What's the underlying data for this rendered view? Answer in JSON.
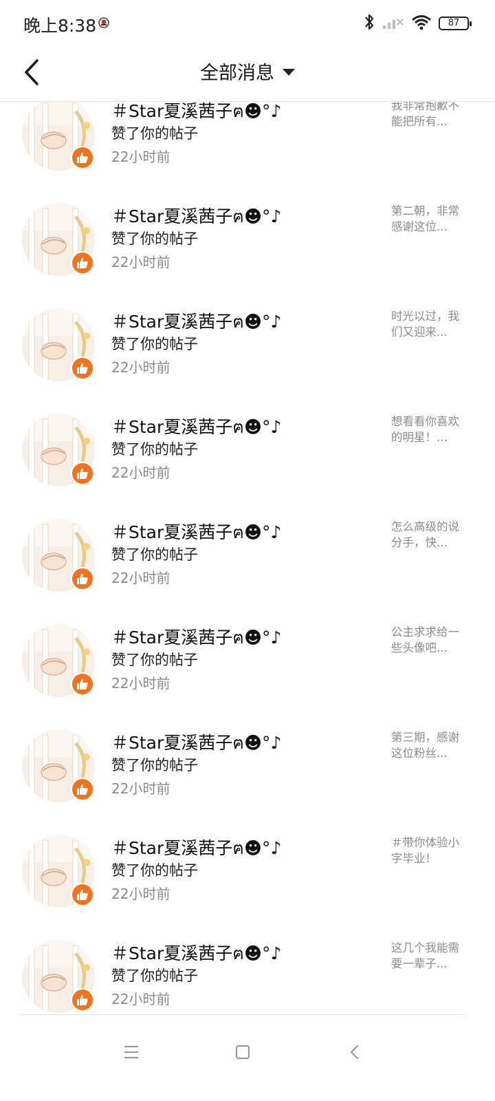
{
  "status_bar": {
    "time": "晚上8:38",
    "battery": "87",
    "icons": [
      "notification-icon",
      "bluetooth-icon",
      "signal-icon",
      "wifi-icon",
      "battery-icon"
    ]
  },
  "header": {
    "title": "全部消息",
    "back_icon": "chevron-left-icon",
    "dropdown_icon": "caret-down-icon"
  },
  "colors": {
    "accent": "#f4721c",
    "text_primary": "#111111",
    "text_secondary": "#8a8a8a"
  },
  "items": [
    {
      "username": "＃Star夏溪茜子ฅ☻°♪",
      "action": "赞了你的帖子",
      "time": "22小时前",
      "preview": "我非常抱歉不能把所有..."
    },
    {
      "username": "＃Star夏溪茜子ฅ☻°♪",
      "action": "赞了你的帖子",
      "time": "22小时前",
      "preview": "第二朝，非常感谢这位..."
    },
    {
      "username": "＃Star夏溪茜子ฅ☻°♪",
      "action": "赞了你的帖子",
      "time": "22小时前",
      "preview": "时光以过，我们又迎来..."
    },
    {
      "username": "＃Star夏溪茜子ฅ☻°♪",
      "action": "赞了你的帖子",
      "time": "22小时前",
      "preview": "想看看你喜欢的明星！..."
    },
    {
      "username": "＃Star夏溪茜子ฅ☻°♪",
      "action": "赞了你的帖子",
      "time": "22小时前",
      "preview": "怎么高级的说分手，快..."
    },
    {
      "username": "＃Star夏溪茜子ฅ☻°♪",
      "action": "赞了你的帖子",
      "time": "22小时前",
      "preview": "公主求求给一些头像吧..."
    },
    {
      "username": "＃Star夏溪茜子ฅ☻°♪",
      "action": "赞了你的帖子",
      "time": "22小时前",
      "preview": "第三期，感谢这位粉丝..."
    },
    {
      "username": "＃Star夏溪茜子ฅ☻°♪",
      "action": "赞了你的帖子",
      "time": "22小时前",
      "preview": "＃带你体验小字毕业！"
    },
    {
      "username": "＃Star夏溪茜子ฅ☻°♪",
      "action": "赞了你的帖子",
      "time": "22小时前",
      "preview": "这几个我能需要一辈子..."
    }
  ],
  "nav": {
    "menu_icon": "menu-icon",
    "home_icon": "home-square-icon",
    "back_icon": "back-triangle-icon"
  }
}
